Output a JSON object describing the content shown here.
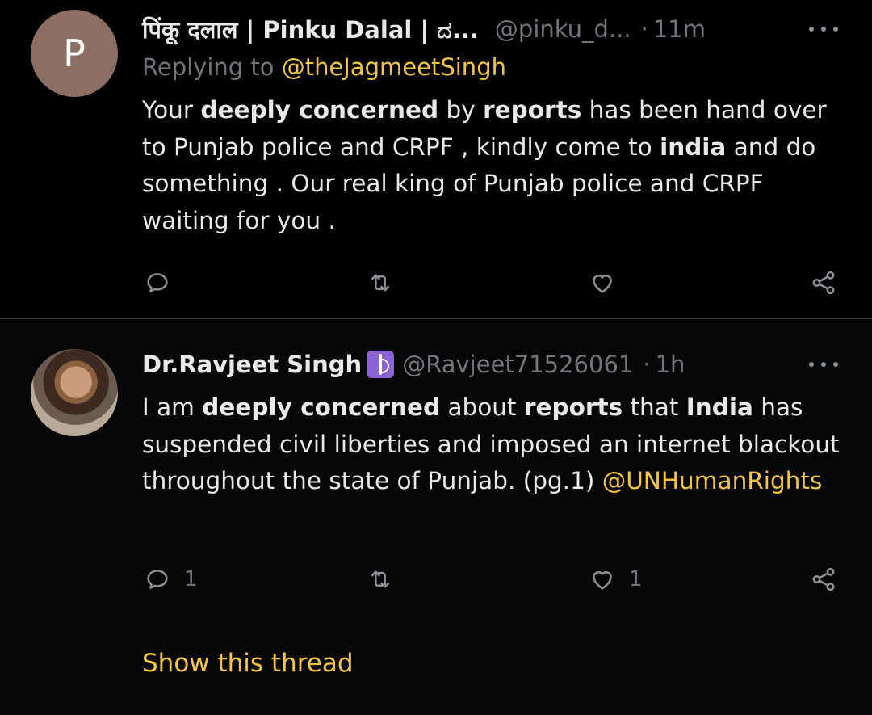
{
  "tweets": [
    {
      "avatar_letter": "P",
      "name": "पिंकू दलाल | Pinku Dalal | ದ...",
      "handle": "@pinku_d...",
      "separator": "·",
      "time": "11m",
      "replying_prefix": "Replying to",
      "replying_to": "@theJagmeetSingh",
      "body": [
        {
          "t": "Your ",
          "b": false
        },
        {
          "t": "deeply concerned",
          "b": true
        },
        {
          "t": " by ",
          "b": false
        },
        {
          "t": "reports",
          "b": true
        },
        {
          "t": " has been hand over to Punjab police and CRPF , kindly come to ",
          "b": false
        },
        {
          "t": "india",
          "b": true
        },
        {
          "t": " and do something . Our real king of Punjab police and CRPF waiting for you .",
          "b": false
        }
      ],
      "reply_count": "",
      "like_count": ""
    },
    {
      "name": "Dr.Ravjeet Singh",
      "badge_icon": "medical-caduceus-icon",
      "handle": "@Ravjeet71526061",
      "separator": "·",
      "time": "1h",
      "body": [
        {
          "t": "I am ",
          "b": false
        },
        {
          "t": "deeply concerned",
          "b": true
        },
        {
          "t": " about ",
          "b": false
        },
        {
          "t": "reports",
          "b": true
        },
        {
          "t": " that ",
          "b": false
        },
        {
          "t": "India",
          "b": true
        },
        {
          "t": " has suspended civil liberties and imposed an internet blackout throughout the state of Punjab. (pg.1) ",
          "b": false
        }
      ],
      "mention": "@UNHumanRights",
      "reply_count": "1",
      "like_count": "1",
      "show_thread": "Show this thread"
    }
  ],
  "colors": {
    "accent": "#f4c542",
    "muted": "#71767b",
    "text": "#e7e9ea",
    "background": "#000000"
  }
}
